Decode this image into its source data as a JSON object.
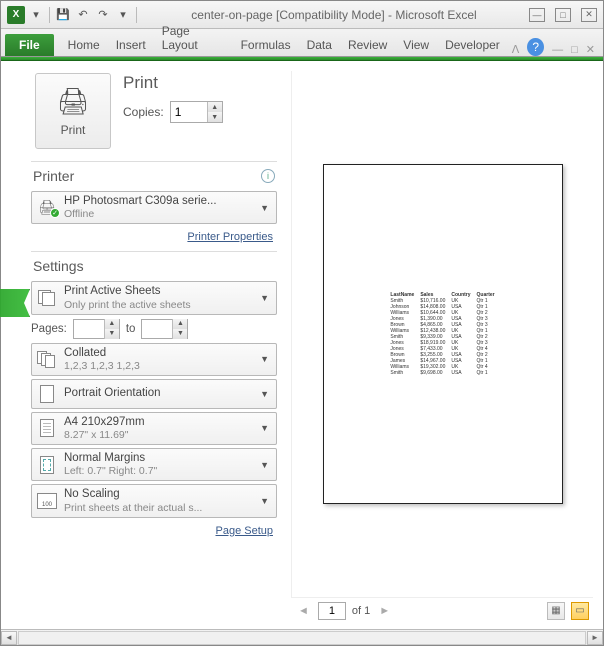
{
  "title": "center-on-page  [Compatibility Mode]  -  Microsoft Excel",
  "ribbon": {
    "file": "File",
    "tabs": [
      "Home",
      "Insert",
      "Page Layout",
      "Formulas",
      "Data",
      "Review",
      "View",
      "Developer"
    ]
  },
  "print": {
    "header": "Print",
    "button": "Print",
    "copies_label": "Copies:",
    "copies_value": "1"
  },
  "printer": {
    "header": "Printer",
    "name": "HP Photosmart C309a serie...",
    "status": "Offline",
    "properties_link": "Printer Properties"
  },
  "settings": {
    "header": "Settings",
    "active_sheets": {
      "main": "Print Active Sheets",
      "sub": "Only print the active sheets"
    },
    "pages_label": "Pages:",
    "pages_to": "to",
    "collated": {
      "main": "Collated",
      "sub": "1,2,3   1,2,3   1,2,3"
    },
    "orientation": {
      "main": "Portrait Orientation",
      "sub": ""
    },
    "paper": {
      "main": "A4 210x297mm",
      "sub": "8.27\" x 11.69\""
    },
    "margins": {
      "main": "Normal Margins",
      "sub": "Left:  0.7\"    Right:  0.7\""
    },
    "scaling": {
      "main": "No Scaling",
      "sub": "Print sheets at their actual s..."
    },
    "page_setup_link": "Page Setup"
  },
  "preview": {
    "current_page": "1",
    "of_label": "of 1",
    "table": {
      "headers": [
        "LastName",
        "Sales",
        "Country",
        "Quarter"
      ],
      "rows": [
        [
          "Smith",
          "$10,716.00",
          "UK",
          "Qtr 1"
        ],
        [
          "Johnson",
          "$14,808.00",
          "USA",
          "Qtr 1"
        ],
        [
          "Williams",
          "$10,644.00",
          "UK",
          "Qtr 2"
        ],
        [
          "Jones",
          "$1,390.00",
          "USA",
          "Qtr 3"
        ],
        [
          "Brown",
          "$4,865.00",
          "USA",
          "Qtr 3"
        ],
        [
          "Williams",
          "$12,438.00",
          "UK",
          "Qtr 1"
        ],
        [
          "Smith",
          "$9,339.00",
          "USA",
          "Qtr 2"
        ],
        [
          "Jones",
          "$18,919.00",
          "UK",
          "Qtr 3"
        ],
        [
          "Jones",
          "$7,433.00",
          "UK",
          "Qtr 4"
        ],
        [
          "Brown",
          "$3,255.00",
          "USA",
          "Qtr 2"
        ],
        [
          "James",
          "$14,967.00",
          "USA",
          "Qtr 1"
        ],
        [
          "Williams",
          "$19,302.00",
          "UK",
          "Qtr 4"
        ],
        [
          "Smith",
          "$9,698.00",
          "USA",
          "Qtr 1"
        ]
      ]
    }
  }
}
